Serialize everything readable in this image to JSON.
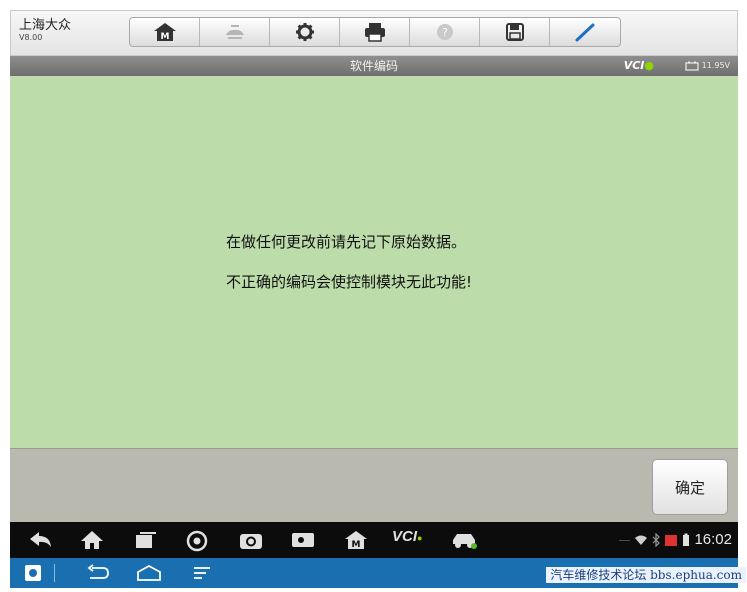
{
  "brand": {
    "name": "上海大众",
    "version": "V8.00"
  },
  "toolbar": {
    "tools": [
      {
        "icon": "home-m-icon"
      },
      {
        "icon": "vehicle-swap-icon"
      },
      {
        "icon": "settings-gear-icon"
      },
      {
        "icon": "printer-icon"
      },
      {
        "icon": "help-icon"
      },
      {
        "icon": "save-icon"
      },
      {
        "icon": "pen-icon"
      }
    ]
  },
  "titlebar": {
    "title": "软件编码",
    "vci": "VCI",
    "battery": "11.95V"
  },
  "content": {
    "line1": "在做任何更改前请先记下原始数据。",
    "line2": "不正确的编码会使控制模块无此功能!"
  },
  "actions": {
    "ok_label": "确定"
  },
  "navbar": {
    "vci_label": "VCI",
    "time": "16:02",
    "icons": [
      "back-icon",
      "home-icon",
      "recent-apps-icon",
      "chrome-icon",
      "camera-icon",
      "display-icon",
      "maxi-home-icon",
      "vci-icon",
      "car-icon"
    ]
  },
  "sysbar": {
    "watermark": "汽车维修技术论坛 bbs.ephua.com"
  },
  "colors": {
    "content_bg": "#bcdcaa",
    "nav_bg": "#0c0c0c",
    "sys_bg": "#1a6fb0",
    "titlebar_bg": "#7a7a7a"
  }
}
